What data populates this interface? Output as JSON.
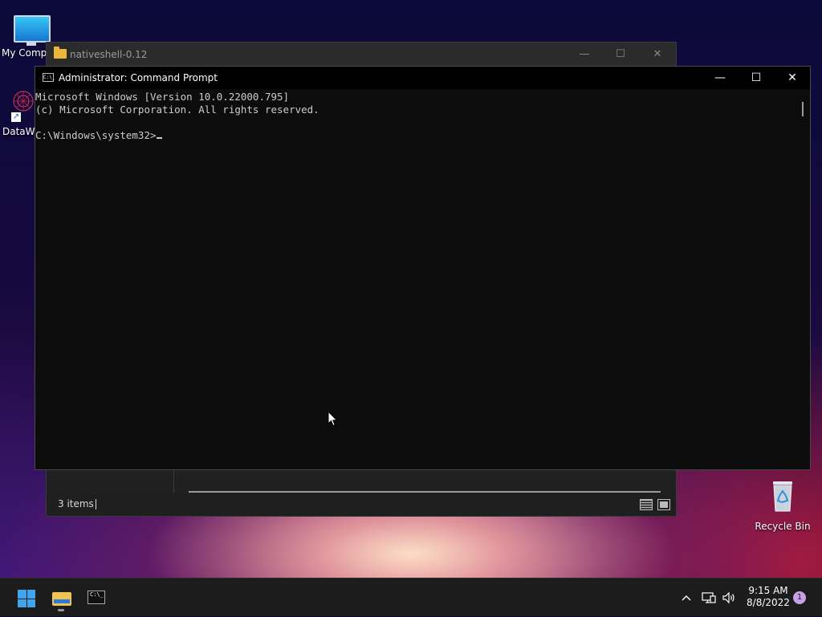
{
  "desktop": {
    "icons": [
      {
        "label": "My Compu",
        "icon": "computer-icon"
      },
      {
        "label": "DataWa",
        "icon": "datawarehouse-icon"
      },
      {
        "label": "Recycle Bin",
        "icon": "recycle-bin-icon"
      }
    ]
  },
  "explorer": {
    "title": "nativeshell-0.12",
    "status_count": "3 items",
    "controls": {
      "minimize": "—",
      "maximize": "☐",
      "close": "✕"
    }
  },
  "cmd": {
    "title": "Administrator: Command Prompt",
    "icon_text": "C:\\_",
    "controls": {
      "minimize": "—",
      "maximize": "☐",
      "close": "✕"
    },
    "lines": [
      "Microsoft Windows [Version 10.0.22000.795]",
      "(c) Microsoft Corporation. All rights reserved.",
      "",
      "C:\\Windows\\system32>"
    ]
  },
  "taskbar": {
    "cmd_icon_text": "C:\\_",
    "tray": {
      "chevron": "^",
      "network": "🖧",
      "volume": "🔊"
    },
    "time": "9:15 AM",
    "date": "8/8/2022",
    "notification_count": "1"
  },
  "colors": {
    "console_bg": "#0c0c0c",
    "console_text": "#cccccc",
    "taskbar_bg": "#1c1c1c",
    "windows_blue": "#41a5ee",
    "folder_yellow": "#e8b73b"
  }
}
